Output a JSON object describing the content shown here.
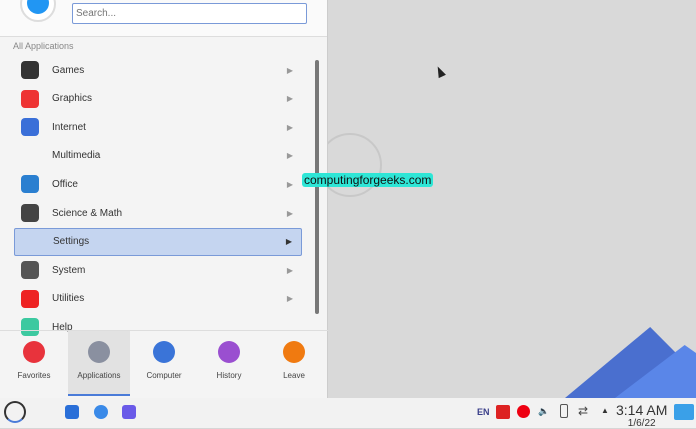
{
  "search": {
    "placeholder": "Search..."
  },
  "section_header": "All Applications",
  "categories": [
    {
      "label": "Games",
      "color": "#333"
    },
    {
      "label": "Graphics",
      "color": "#e33"
    },
    {
      "label": "Internet",
      "color": "#3a6fd8"
    },
    {
      "label": "Multimedia",
      "color": "transparent"
    },
    {
      "label": "Office",
      "color": "#2a7fd0"
    },
    {
      "label": "Science & Math",
      "color": "#444"
    },
    {
      "label": "Settings",
      "color": "transparent"
    },
    {
      "label": "System",
      "color": "#555"
    },
    {
      "label": "Utilities",
      "color": "#e22"
    },
    {
      "label": "Help",
      "color": "#3cc9a0"
    }
  ],
  "selected": "Settings",
  "tabs": [
    {
      "label": "Favorites",
      "color": "#e8333c"
    },
    {
      "label": "Applications",
      "color": "#8a90a0"
    },
    {
      "label": "Computer",
      "color": "#3a74d8"
    },
    {
      "label": "History",
      "color": "#9a4fd0"
    },
    {
      "label": "Leave",
      "color": "#f07a10"
    }
  ],
  "active_tab": "Applications",
  "watermark": "computingforgeeks.com",
  "tray": {
    "lang": "EN",
    "time": "3:14 AM",
    "date": "1/6/22"
  }
}
